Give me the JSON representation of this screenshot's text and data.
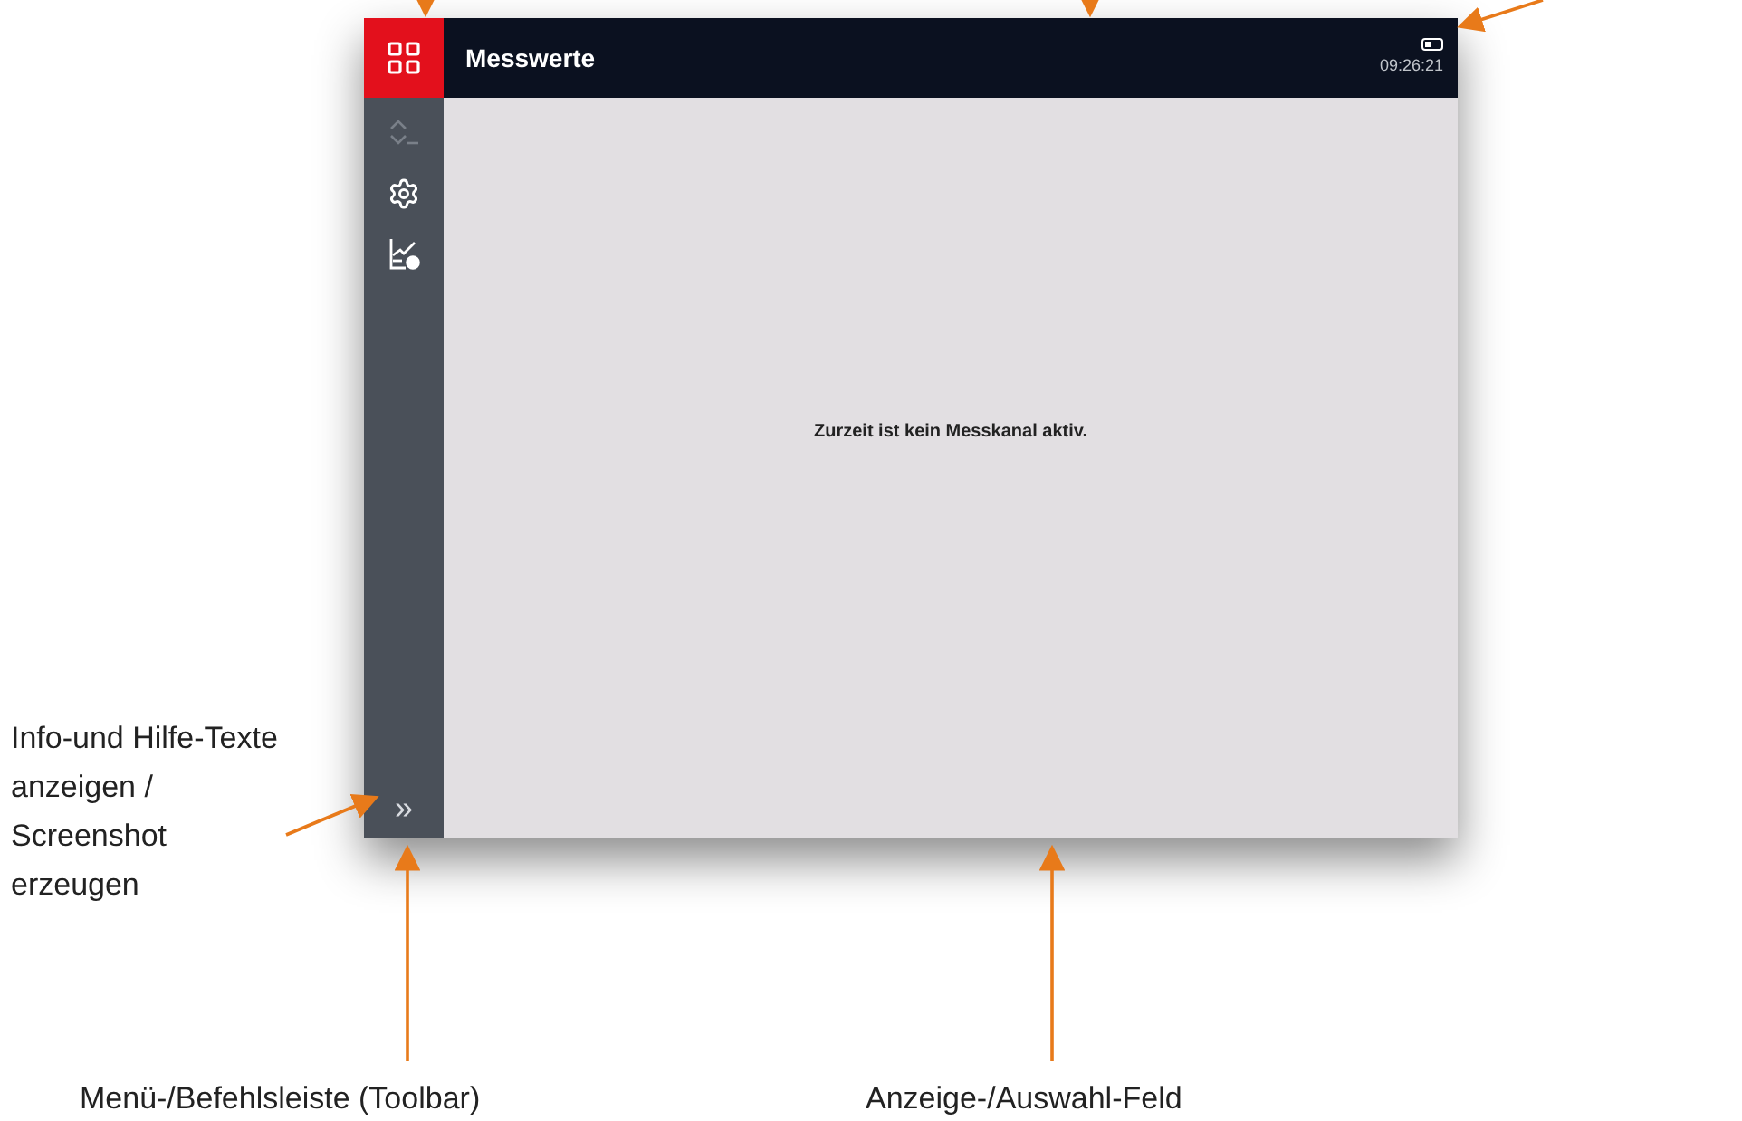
{
  "screen": {
    "title": "Messwerte",
    "time": "09:26:21",
    "home_button": {
      "selected": true
    },
    "toolbar": [
      {
        "kind": "sensor",
        "disabled": true
      },
      {
        "kind": "settings",
        "disabled": false
      },
      {
        "kind": "chart",
        "disabled": false
      }
    ],
    "expand_button": {
      "label": "»"
    },
    "message": "Zurzeit ist kein Messkanal aktiv."
  },
  "annotations": {
    "side_note": "Info-und Hilfe-Texte anzeigen / Screenshot erzeugen",
    "toolbar_note": "Menü-/Befehlsleiste (Toolbar)",
    "field_note": "Anzeige-/Auswahl-Feld"
  }
}
